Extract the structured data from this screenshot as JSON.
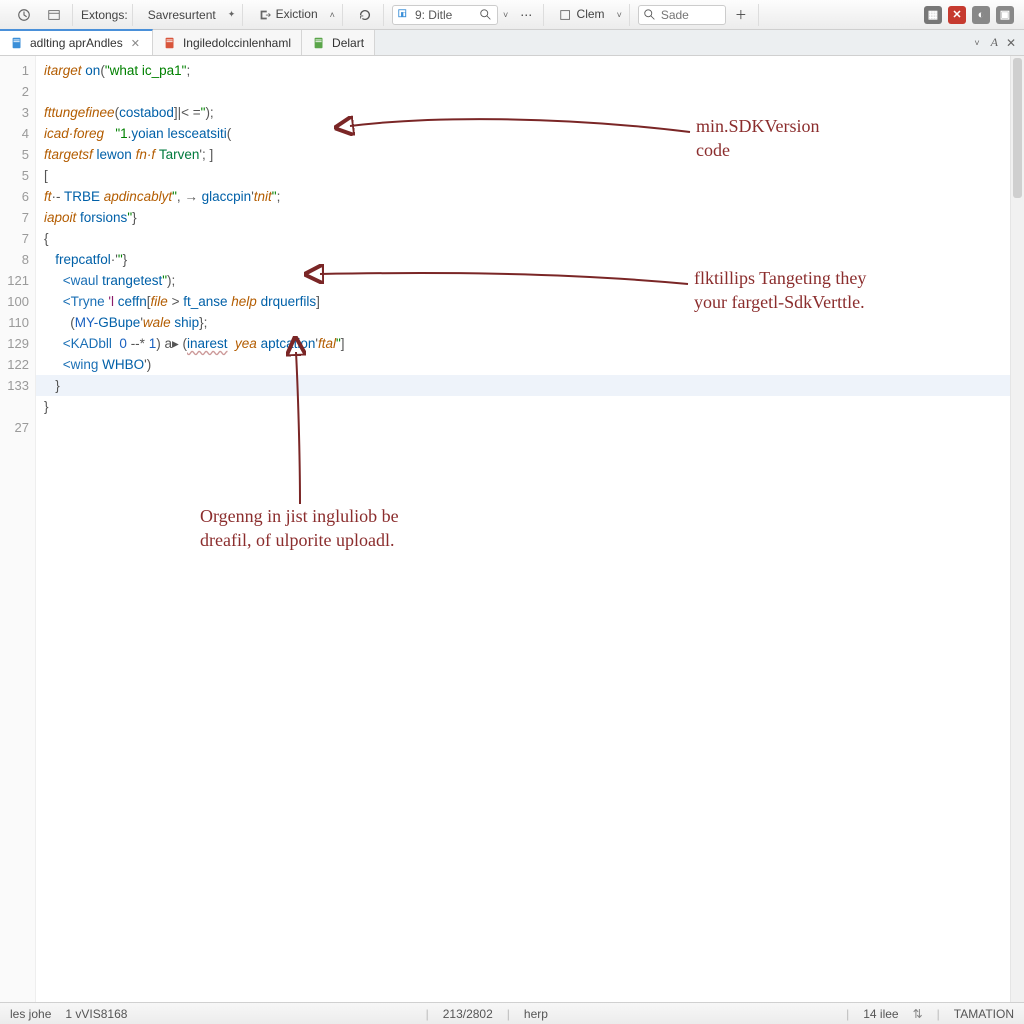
{
  "toolbar": {
    "extensions_label": "Extongs:",
    "nav_label": "Savresurtent",
    "exit_label": "Exiction",
    "search1_value": "9: Ditle",
    "clem_label": "Clem",
    "search2_placeholder": "Sade"
  },
  "tabs": {
    "items": [
      {
        "label": "adlting aprAndles",
        "active": true,
        "icon_color": "#3b8fd8"
      },
      {
        "label": "Ingiledolccinlenhaml",
        "active": false,
        "icon_color": "#d8553b"
      },
      {
        "label": "Delart",
        "active": false,
        "icon_color": "#5aa54a"
      }
    ]
  },
  "gutter": [
    "1",
    "2",
    "3",
    "4",
    "5",
    "5",
    "6",
    "7",
    "7",
    "8",
    "121",
    "100",
    "110",
    "129",
    "122",
    "133",
    "",
    "27"
  ],
  "code_lines": [
    {
      "tokens": [
        [
          "kw1",
          "itarget "
        ],
        [
          "kw2",
          "on"
        ],
        [
          "op",
          "("
        ],
        [
          "str",
          "\"what ic_pa1\""
        ],
        [
          "op",
          ";"
        ]
      ]
    },
    {
      "tokens": []
    },
    {
      "tokens": [
        [
          "kw1",
          "fttungefinee"
        ],
        [
          "op",
          "("
        ],
        [
          "kw2",
          "costabod"
        ],
        [
          "op",
          "]|< ="
        ],
        [
          "str",
          "\""
        ],
        [
          "op",
          ");"
        ]
      ]
    },
    {
      "tokens": [
        [
          "kw1",
          "icad·foreg"
        ],
        [
          "op",
          "   "
        ],
        [
          "str",
          "\"1"
        ],
        [
          "op",
          "."
        ],
        [
          "kw2",
          "yoian"
        ],
        [
          "op",
          " "
        ],
        [
          "kw2",
          "lesceatsiti"
        ],
        [
          "op",
          "("
        ]
      ]
    },
    {
      "tokens": [
        [
          "kw1",
          "ftargetsf "
        ],
        [
          "kw2",
          "lewon "
        ],
        [
          "kw1",
          "fn·f "
        ],
        [
          "kw3",
          "Tarven"
        ],
        [
          "op",
          "'"
        ],
        [
          "op",
          "; ]"
        ]
      ]
    },
    {
      "tokens": [
        [
          "op",
          "["
        ]
      ]
    },
    {
      "tokens": [
        [
          "kw1",
          "ft"
        ],
        [
          "op",
          "·- "
        ],
        [
          "kw2",
          "TRBE "
        ],
        [
          "kw1",
          "apdincablyt"
        ],
        [
          "str",
          "\""
        ],
        [
          "op",
          ", → "
        ],
        [
          "kw2",
          "glaccpin"
        ],
        [
          "op",
          "'"
        ],
        [
          "kw1",
          "tnit"
        ],
        [
          "str",
          "\""
        ],
        [
          "op",
          ";"
        ]
      ]
    },
    {
      "tokens": [
        [
          "kw1",
          "iapoit "
        ],
        [
          "kw2",
          "forsions"
        ],
        [
          "str",
          "\""
        ],
        [
          "op",
          "}"
        ]
      ]
    },
    {
      "tokens": [
        [
          "op",
          "{"
        ]
      ]
    },
    {
      "tokens": [
        [
          "op",
          "   "
        ],
        [
          "kw2",
          "frepcatfol"
        ],
        [
          "op",
          "·'"
        ],
        [
          "str",
          "\""
        ],
        [
          "op",
          "}"
        ]
      ]
    },
    {
      "tokens": [
        [
          "op",
          "     "
        ],
        [
          "tag",
          "<waul "
        ],
        [
          "kw2",
          "trangetest"
        ],
        [
          "str",
          "\""
        ],
        [
          "op",
          ");"
        ]
      ]
    },
    {
      "tokens": [
        [
          "op",
          "     "
        ],
        [
          "tag",
          "<Tryne "
        ],
        [
          "attr",
          "'l "
        ],
        [
          "kw2",
          "ceffn"
        ],
        [
          "op",
          "["
        ],
        [
          "kw1",
          "file"
        ],
        [
          "op",
          " > "
        ],
        [
          "kw2",
          "ft_anse"
        ],
        [
          "op",
          " "
        ],
        [
          "kw1",
          "help"
        ],
        [
          "op",
          " "
        ],
        [
          "kw2",
          "drquerfils"
        ],
        [
          "op",
          "]"
        ]
      ]
    },
    {
      "tokens": [
        [
          "op",
          "       ("
        ],
        [
          "num",
          "MY-"
        ],
        [
          "kw2",
          "GBupe"
        ],
        [
          "op",
          "'"
        ],
        [
          "kw1",
          "wale "
        ],
        [
          "kw2",
          "ship"
        ],
        [
          "op",
          "};"
        ]
      ]
    },
    {
      "tokens": [
        [
          "op",
          "     "
        ],
        [
          "tag",
          "<KADbll  "
        ],
        [
          "num",
          "0"
        ],
        [
          "op",
          " --* "
        ],
        [
          "num",
          "1"
        ],
        [
          "op",
          ") a▸ ("
        ],
        [
          "kw2 underl",
          "inarest"
        ],
        [
          "op",
          "  "
        ],
        [
          "kw1",
          "yea "
        ],
        [
          "kw2",
          "aptcation"
        ],
        [
          "op",
          "'"
        ],
        [
          "kw1",
          "ftal"
        ],
        [
          "str",
          "\""
        ],
        [
          "op",
          "]"
        ]
      ]
    },
    {
      "tokens": [
        [
          "op",
          "     "
        ],
        [
          "tag",
          "<wing "
        ],
        [
          "kw2",
          "WHBO"
        ],
        [
          "op",
          "')"
        ]
      ]
    },
    {
      "tokens": [
        [
          "op",
          "   }"
        ]
      ]
    },
    {
      "tokens": [
        [
          "op",
          "}"
        ]
      ]
    },
    {
      "tokens": []
    }
  ],
  "annotations": {
    "a1": "min.SDKVersion\ncode",
    "a2": "flktillips Tangeting they\nyour fargetl-SdkVerttle.",
    "a3": "Orgenng in jist ingluliob be\ndreafil, of ulporite uploadl."
  },
  "statusbar": {
    "left1": "les johe",
    "left2": "1 vVIS8168",
    "pos": "213/2802",
    "help": "herp",
    "right1": "14 ilee",
    "right2": "TAMATION"
  }
}
